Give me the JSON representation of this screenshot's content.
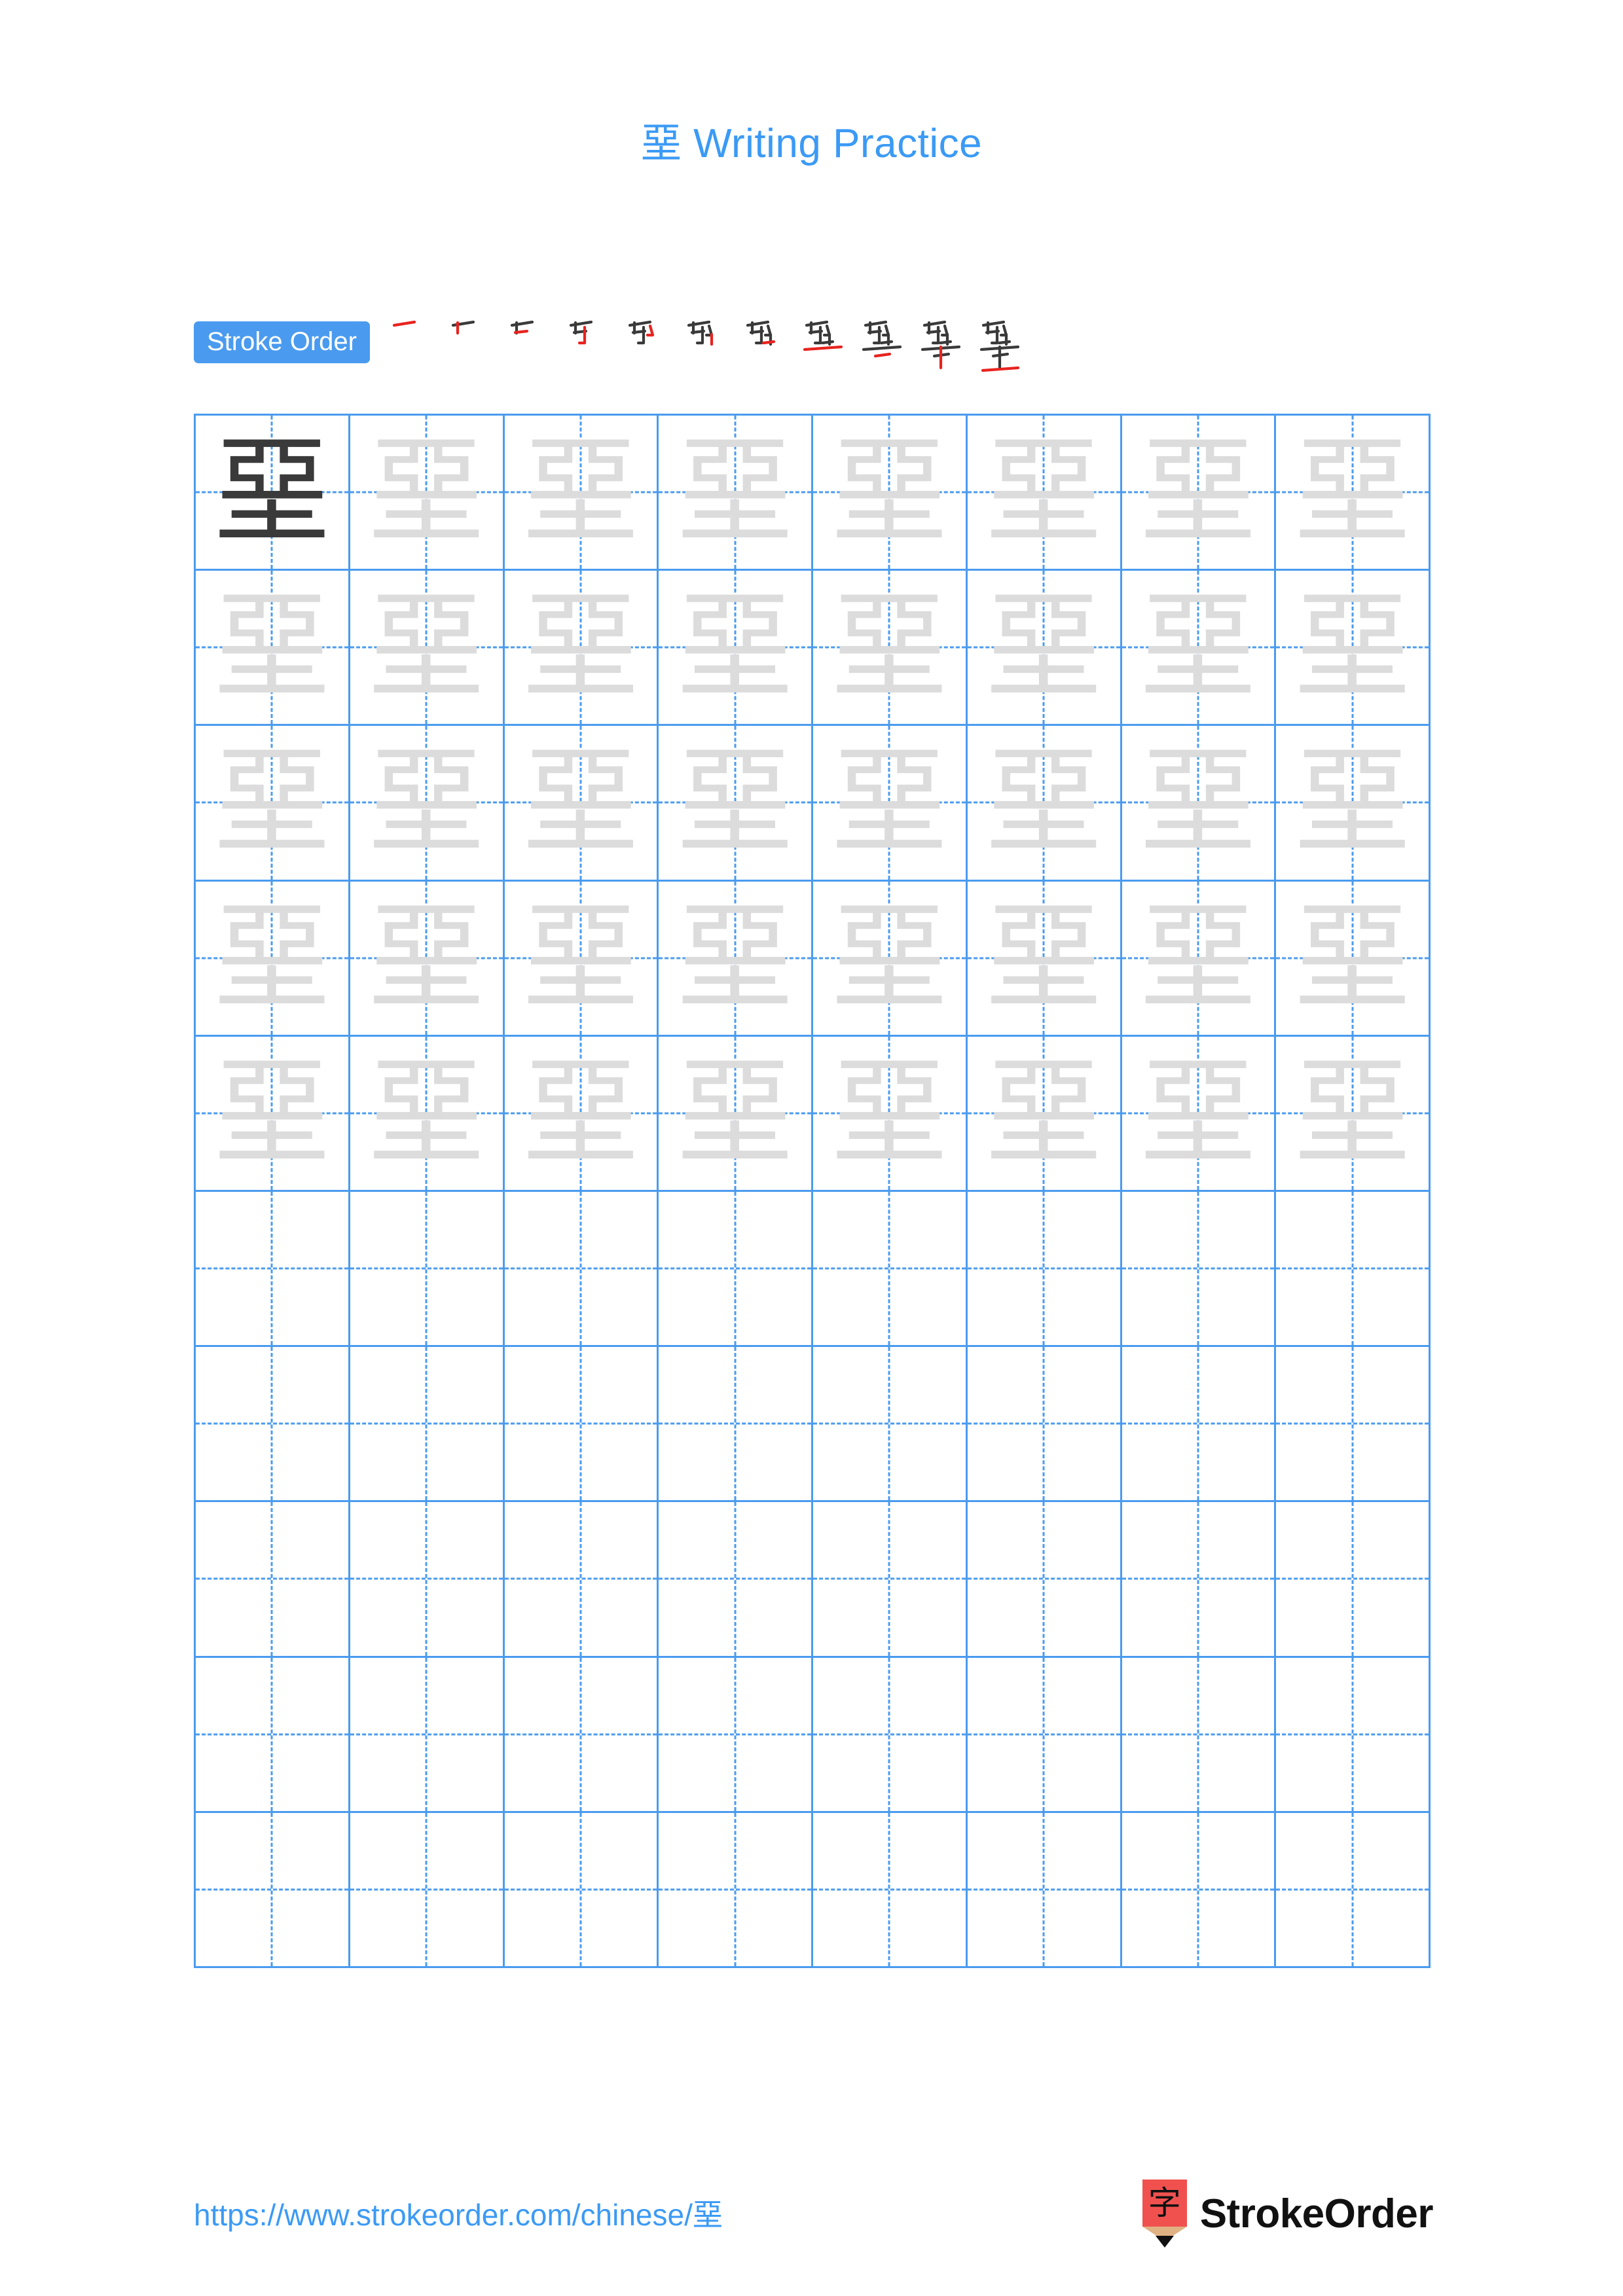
{
  "page": {
    "character": "堊",
    "title": "堊 Writing Practice",
    "background_color": "#ffffff",
    "accent_color": "#4a9bef",
    "title_color": "#3b9af5",
    "model_glyph_color": "#3a3a3a",
    "trace_glyph_color": "#dcdcdc",
    "new_stroke_color": "#e8231f"
  },
  "stroke_order": {
    "label": "Stroke Order",
    "total_strokes": 11,
    "steps": [
      {
        "index": 1,
        "strokes_shown": 1,
        "new_stroke": 1
      },
      {
        "index": 2,
        "strokes_shown": 2,
        "new_stroke": 2
      },
      {
        "index": 3,
        "strokes_shown": 3,
        "new_stroke": 3
      },
      {
        "index": 4,
        "strokes_shown": 4,
        "new_stroke": 4
      },
      {
        "index": 5,
        "strokes_shown": 5,
        "new_stroke": 5
      },
      {
        "index": 6,
        "strokes_shown": 6,
        "new_stroke": 6
      },
      {
        "index": 7,
        "strokes_shown": 7,
        "new_stroke": 7
      },
      {
        "index": 8,
        "strokes_shown": 8,
        "new_stroke": 8
      },
      {
        "index": 9,
        "strokes_shown": 9,
        "new_stroke": 9
      },
      {
        "index": 10,
        "strokes_shown": 10,
        "new_stroke": 10
      },
      {
        "index": 11,
        "strokes_shown": 11,
        "new_stroke": 11
      }
    ]
  },
  "practice_grid": {
    "columns": 8,
    "rows": 10,
    "filled_rows": 5,
    "empty_rows": 5,
    "model_cell": {
      "row": 1,
      "column": 1
    },
    "cell_character": "堊"
  },
  "footer": {
    "url": "https://www.strokeorder.com/chinese/堊",
    "brand_name": "StrokeOrder",
    "logo_character": "字"
  }
}
